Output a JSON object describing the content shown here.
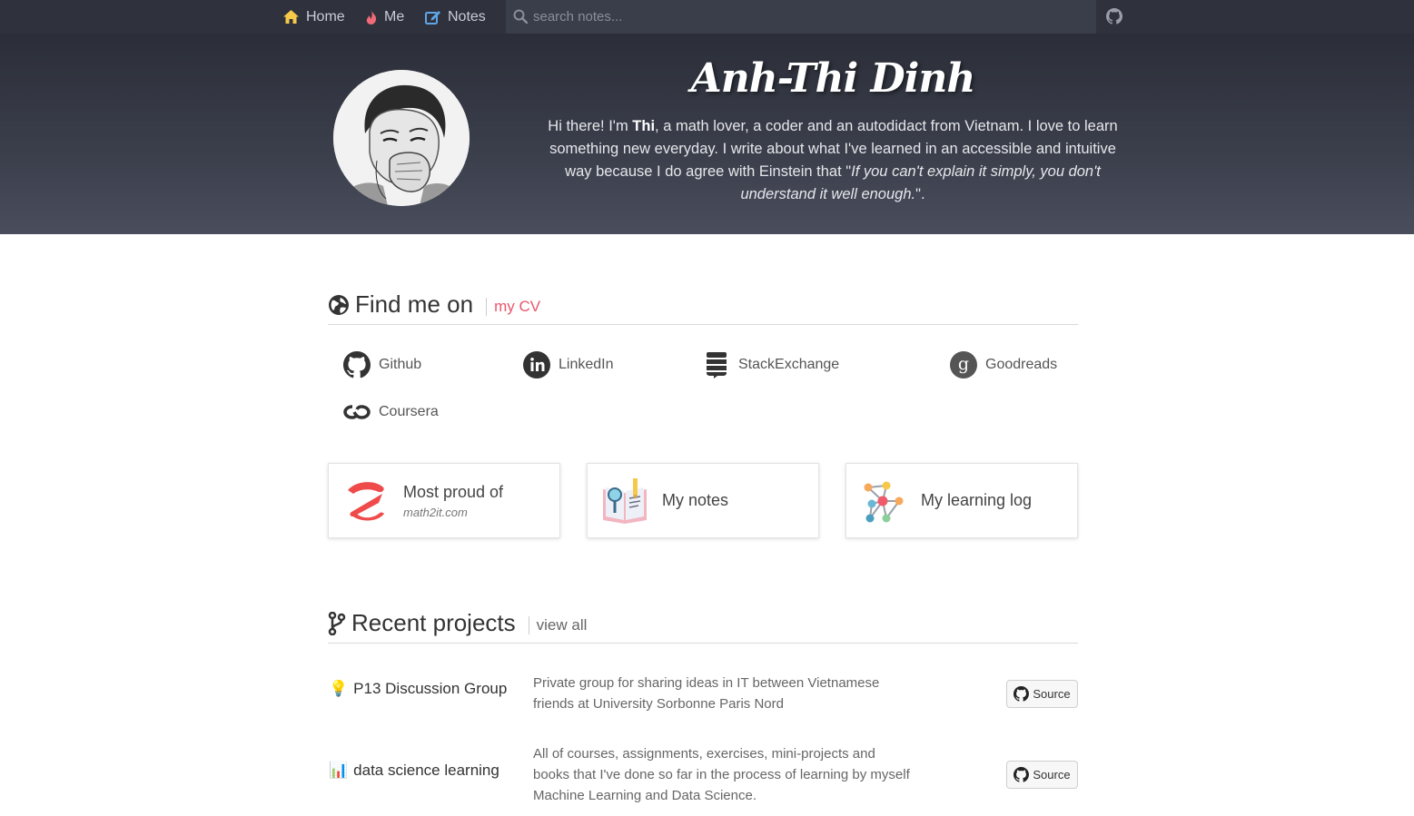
{
  "nav": {
    "home": "Home",
    "me": "Me",
    "notes": "Notes",
    "search_placeholder": "search notes...",
    "icons": {
      "home": "home-icon",
      "me": "fire-icon",
      "notes": "edit-icon",
      "search": "search-icon",
      "github": "github-icon"
    },
    "colors": {
      "home": "#f6c94b",
      "me": "#f06a78",
      "notes": "#5fa6e8"
    }
  },
  "hero": {
    "name": "Anh-Thi Dinh",
    "bio_intro": "Hi there! I'm ",
    "bio_name": "Thi",
    "bio_body": ", a math lover, a coder and an autodidact from Vietnam. I love to learn something new everyday. I write about what I've learned in an accessible and intuitive way because I do agree with Einstein that \"",
    "bio_quote": "If you can't explain it simply, you don't understand it well enough.",
    "bio_end": "\"."
  },
  "findme": {
    "title": "Find me on",
    "cv_link": "my CV",
    "links": [
      {
        "label": "Github",
        "icon": "github-icon"
      },
      {
        "label": "LinkedIn",
        "icon": "linkedin-icon"
      },
      {
        "label": "StackExchange",
        "icon": "stackexchange-icon"
      },
      {
        "label": "Goodreads",
        "icon": "goodreads-icon"
      },
      {
        "label": "Coursera",
        "icon": "coursera-icon"
      }
    ]
  },
  "cards": [
    {
      "title": "Most proud of",
      "subtitle": "math2it.com",
      "icon": "math2it-logo-icon"
    },
    {
      "title": "My notes",
      "icon": "notebook-icon"
    },
    {
      "title": "My learning log",
      "icon": "network-icon"
    }
  ],
  "projects": {
    "title": "Recent projects",
    "view_all": "view all",
    "items": [
      {
        "emoji": "💡",
        "name": "P13 Discussion Group",
        "desc": "Private group for sharing ideas in IT between Vietnamese friends at University Sorbonne Paris Nord",
        "button": "Source"
      },
      {
        "emoji": "📊",
        "name": "data science learning",
        "desc": "All of courses, assignments, exercises, mini-projects and books that I've done so far in the process of learning by myself Machine Learning and Data Science.",
        "button": "Source"
      }
    ]
  },
  "colors": {
    "accent": "#e8566c",
    "nav_bg": "#2f323d",
    "hero_bg": "#3b3f4c"
  }
}
